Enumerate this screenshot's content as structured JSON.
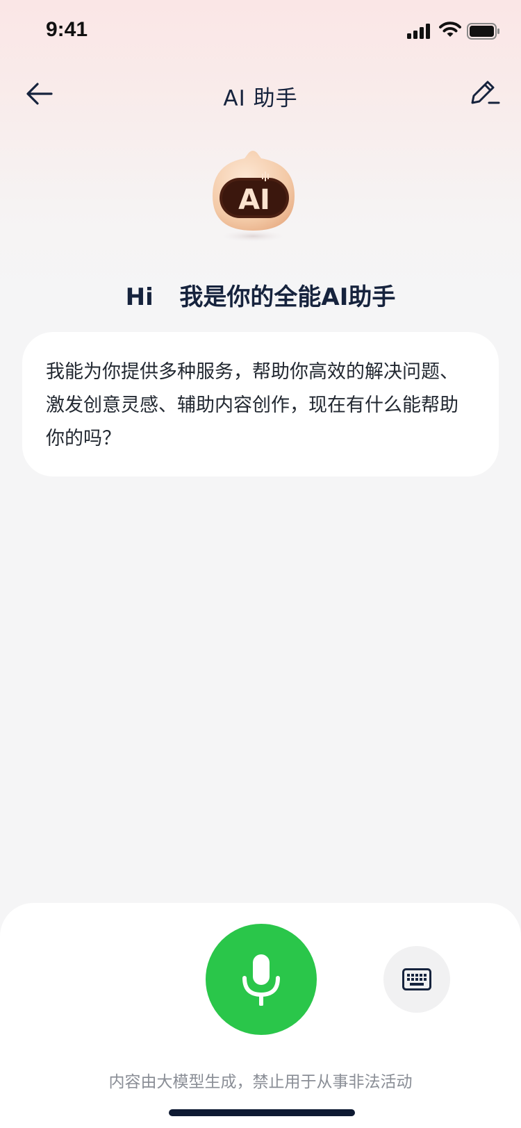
{
  "status_bar": {
    "time": "9:41"
  },
  "header": {
    "title": "AI 助手"
  },
  "mascot": {
    "badge_text": "AI"
  },
  "greeting": {
    "hi": "Hi",
    "text": "我是你的全能AI助手"
  },
  "message": {
    "text": "我能为你提供多种服务，帮助你高效的解决问题、激发创意灵感、辅助内容创作，现在有什么能帮助你的吗？"
  },
  "footer": {
    "disclaimer": "内容由大模型生成，禁止用于从事非法活动"
  },
  "colors": {
    "accent_green": "#2ac64a",
    "title_text": "#16233d",
    "mascot_body": "#f3c9a6",
    "mascot_face": "#4a1f12"
  },
  "icons": [
    "signal-icon",
    "wifi-icon",
    "battery-icon",
    "back-arrow-icon",
    "edit-icon",
    "microphone-icon",
    "keyboard-icon"
  ]
}
